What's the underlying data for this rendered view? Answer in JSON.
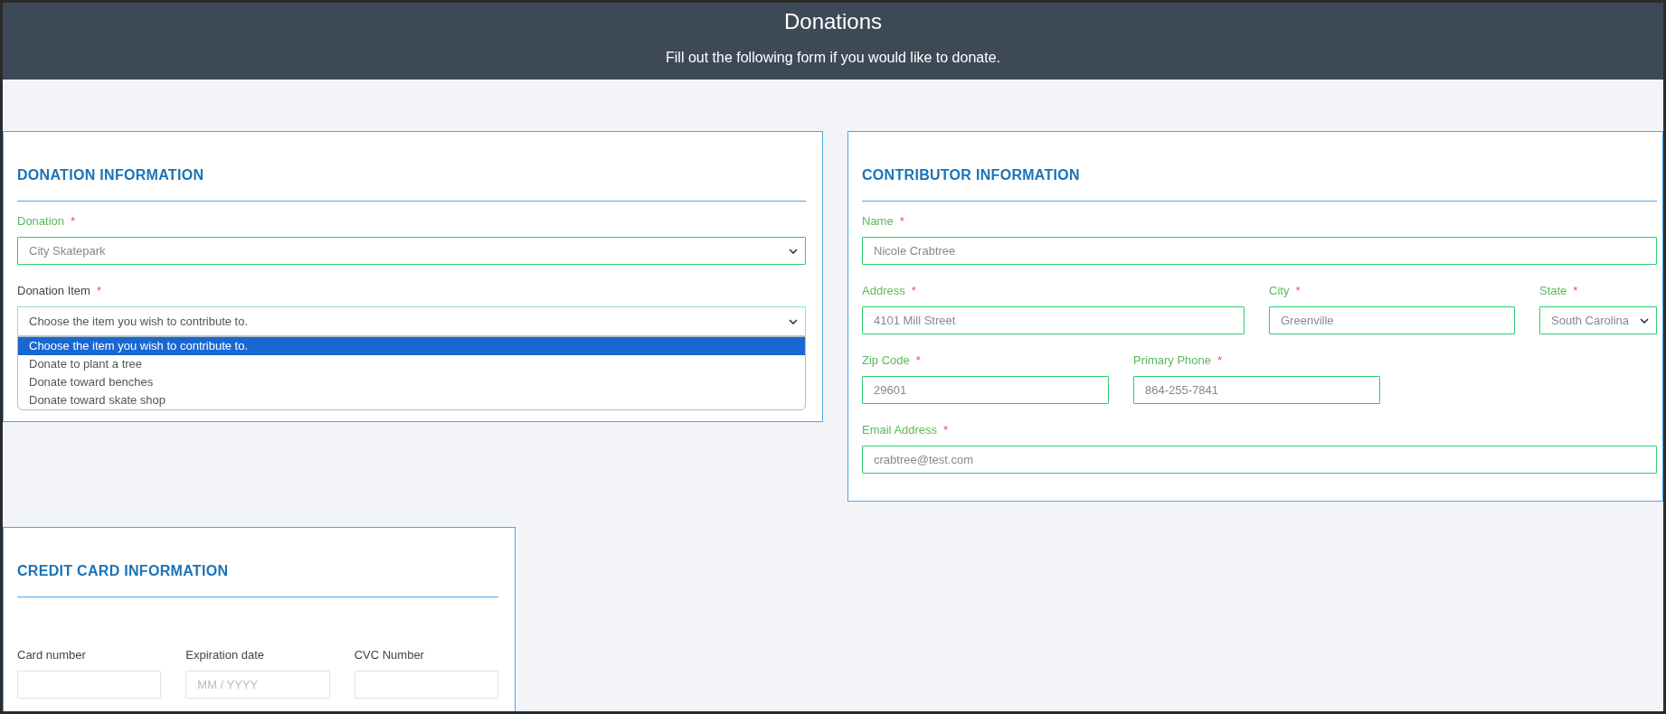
{
  "header": {
    "title": "Donations",
    "subtitle": "Fill out the following form if you would like to donate."
  },
  "sections": [
    {
      "kind": "donation",
      "title": "DONATION INFORMATION",
      "rows": [
        {
          "fields": [
            {
              "kind": "select",
              "label": "Donation",
              "marker": "*",
              "valid": true,
              "focused": false,
              "value": "City Skatepark"
            }
          ]
        },
        {
          "fields": [
            {
              "kind": "select",
              "label": "Donation Item",
              "marker": "*",
              "valid": false,
              "focused": true,
              "value": "Choose the item you wish to contribute to.",
              "open": true,
              "options": [
                {
                  "label": "Choose the item you wish to contribute to.",
                  "selected": true
                },
                {
                  "label": "Donate to plant a tree",
                  "selected": false
                },
                {
                  "label": "Donate toward benches",
                  "selected": false
                },
                {
                  "label": "Donate toward skate shop",
                  "selected": false
                }
              ]
            }
          ]
        }
      ]
    },
    {
      "kind": "contributor",
      "title": "CONTRIBUTOR INFORMATION",
      "rows": [
        {
          "fields": [
            {
              "kind": "text",
              "label": "Name",
              "marker": "*",
              "valid": true,
              "focused": false,
              "value": "Nicole Crabtree"
            }
          ]
        },
        {
          "fields": [
            {
              "kind": "text",
              "label": "Address",
              "marker": "*",
              "valid": true,
              "focused": false,
              "value": "4101 Mill Street"
            },
            {
              "kind": "text",
              "label": "City",
              "marker": "*",
              "valid": true,
              "focused": false,
              "value": "Greenville"
            },
            {
              "kind": "select",
              "label": "State",
              "marker": "*",
              "valid": true,
              "focused": false,
              "value": "South Carolina"
            }
          ]
        },
        {
          "fields": [
            {
              "kind": "text",
              "label": "Zip Code",
              "marker": "*",
              "valid": true,
              "focused": false,
              "value": "29601"
            },
            {
              "kind": "text",
              "label": "Primary Phone",
              "marker": "*",
              "valid": true,
              "focused": false,
              "value": "864-255-7841"
            }
          ]
        },
        {
          "fields": [
            {
              "kind": "text",
              "label": "Email Address",
              "marker": "*",
              "valid": true,
              "focused": false,
              "value": "crabtree@test.com"
            }
          ]
        }
      ]
    },
    {
      "kind": "card",
      "title": "CREDIT CARD INFORMATION",
      "rows": [
        {
          "fields": [
            {
              "kind": "text",
              "label": "Card number",
              "valid": false,
              "focused": false
            },
            {
              "kind": "text",
              "label": "Expiration date",
              "valid": false,
              "focused": false,
              "placeholder": "MM / YYYY"
            },
            {
              "kind": "text",
              "label": "CVC Number",
              "valid": false,
              "focused": false
            }
          ]
        }
      ]
    }
  ]
}
